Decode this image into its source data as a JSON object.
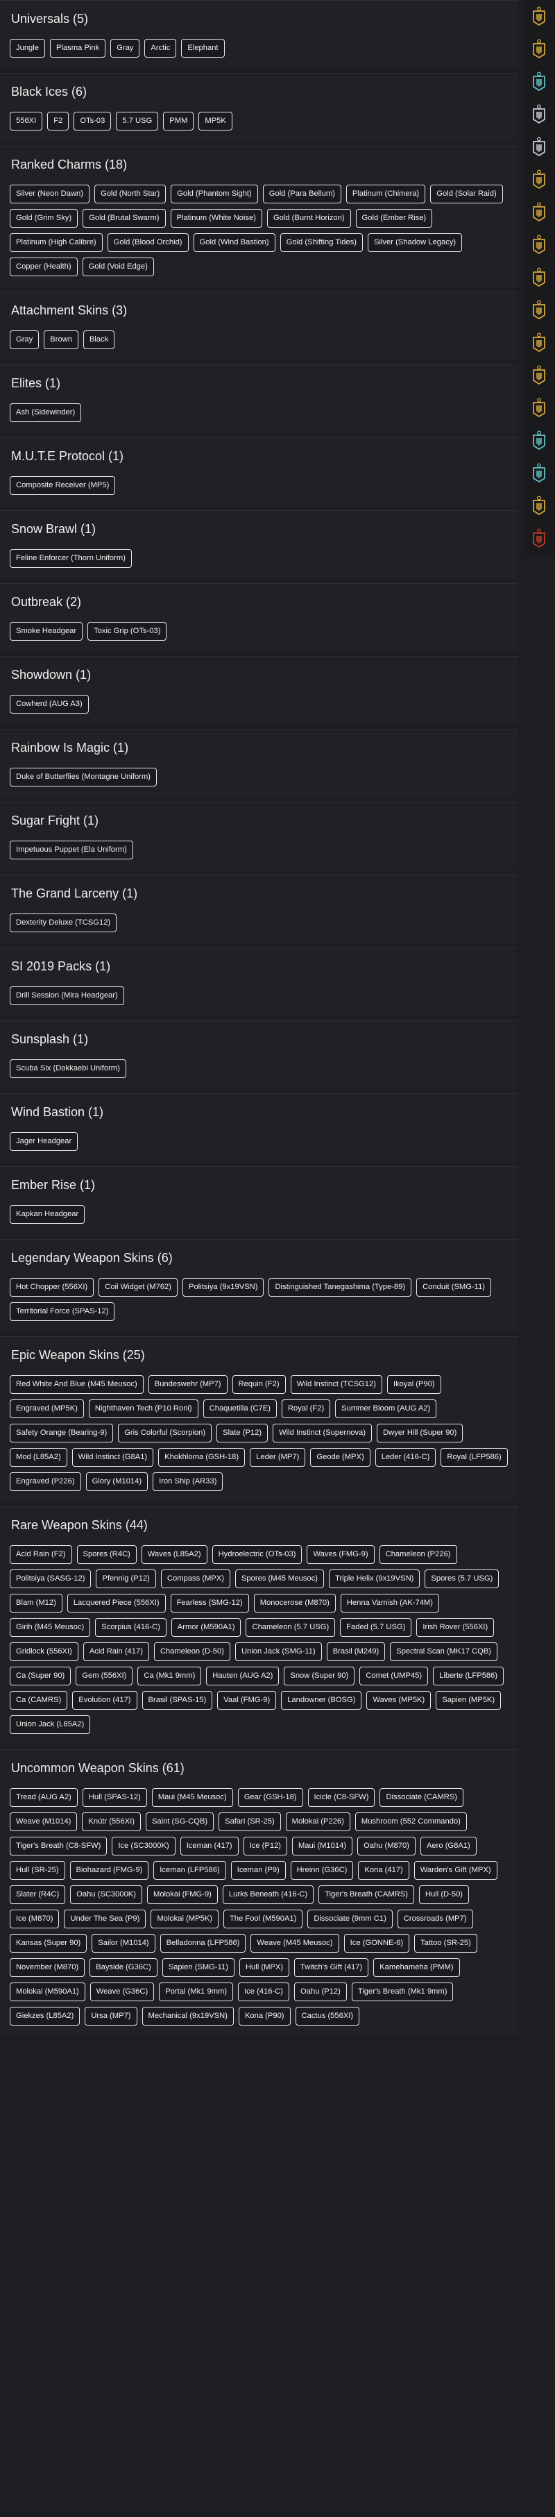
{
  "sections": [
    {
      "title": "Universals (5)",
      "items": [
        "Jungle",
        "Plasma Pink",
        "Gray",
        "Arctic",
        "Elephant"
      ]
    },
    {
      "title": "Black Ices (6)",
      "items": [
        "556XI",
        "F2",
        "OTs-03",
        "5.7 USG",
        "PMM",
        "MP5K"
      ]
    },
    {
      "title": "Ranked Charms (18)",
      "items": [
        "Silver (Neon Dawn)",
        "Gold (North Star)",
        "Gold (Phantom Sight)",
        "Gold (Para Bellum)",
        "Platinum (Chimera)",
        "Gold (Solar Raid)",
        "Gold (Grim Sky)",
        "Gold (Brutal Swarm)",
        "Platinum (White Noise)",
        "Gold (Burnt Horizon)",
        "Gold (Ember Rise)",
        "Platinum (High Calibre)",
        "Gold (Blood Orchid)",
        "Gold (Wind Bastion)",
        "Gold (Shifting Tides)",
        "Silver (Shadow Legacy)",
        "Copper (Health)",
        "Gold (Void Edge)"
      ]
    },
    {
      "title": "Attachment Skins (3)",
      "items": [
        "Gray",
        "Brown",
        "Black"
      ]
    },
    {
      "title": "Elites (1)",
      "items": [
        "Ash (Sidewinder)"
      ]
    },
    {
      "title": "M.U.T.E Protocol (1)",
      "items": [
        "Composite Receiver (MP5)"
      ]
    },
    {
      "title": "Snow Brawl (1)",
      "items": [
        "Feline Enforcer (Thorn Uniform)"
      ]
    },
    {
      "title": "Outbreak (2)",
      "items": [
        "Smoke Headgear",
        "Toxic Grip (OTs-03)"
      ]
    },
    {
      "title": "Showdown (1)",
      "items": [
        "Cowherd (AUG A3)"
      ]
    },
    {
      "title": "Rainbow Is Magic (1)",
      "items": [
        "Duke of Butterflies (Montagne Uniform)"
      ]
    },
    {
      "title": "Sugar Fright (1)",
      "items": [
        "Impetuous Puppet (Ela Uniform)"
      ]
    },
    {
      "title": "The Grand Larceny (1)",
      "items": [
        "Dexterity Deluxe (TCSG12)"
      ]
    },
    {
      "title": "SI 2019 Packs (1)",
      "items": [
        "Drill Session (Mira Headgear)"
      ]
    },
    {
      "title": "Sunsplash (1)",
      "items": [
        "Scuba Six (Dokkaebi Uniform)"
      ]
    },
    {
      "title": "Wind Bastion (1)",
      "items": [
        "Jager Headgear"
      ]
    },
    {
      "title": "Ember Rise (1)",
      "items": [
        "Kapkan Headgear"
      ]
    },
    {
      "title": "Legendary Weapon Skins (6)",
      "items": [
        "Hot Chopper (556XI)",
        "Coil Widget (M762)",
        "Politsiya (9x19VSN)",
        "Distinguished Tanegashima (Type-89)",
        "Conduit (SMG-11)",
        "Territorial Force (SPAS-12)"
      ]
    },
    {
      "title": "Epic Weapon Skins (25)",
      "items": [
        "Red White And Blue (M45 Meusoc)",
        "Bundeswehr (MP7)",
        "Requin (F2)",
        "Wild Instinct (TCSG12)",
        "Ikoyal (P90)",
        "Engraved (MP5K)",
        "Nighthaven Tech (P10 Roni)",
        "Chaquetilla (C7E)",
        "Royal (F2)",
        "Summer Bloom (AUG A2)",
        "Safety Orange (Bearing-9)",
        "Gris Colorful (Scorpion)",
        "Slate (P12)",
        "Wild Instinct (Supernova)",
        "Dwyer Hill (Super 90)",
        "Mod (L85A2)",
        "Wild Instinct (G8A1)",
        "Khokhloma (GSH-18)",
        "Leder (MP7)",
        "Geode (MPX)",
        "Leder (416-C)",
        "Royal (LFP586)",
        "Engraved (P226)",
        "Glory (M1014)",
        "Iron Ship (AR33)"
      ]
    },
    {
      "title": "Rare Weapon Skins (44)",
      "items": [
        "Acid Rain (F2)",
        "Spores (R4C)",
        "Waves (L85A2)",
        "Hydroelectric (OTs-03)",
        "Waves (FMG-9)",
        "Chameleon (P226)",
        "Politsiya (SASG-12)",
        "Pfennig (P12)",
        "Compass (MPX)",
        "Spores (M45 Meusoc)",
        "Triple Helix (9x19VSN)",
        "Spores (5.7 USG)",
        "Blam (M12)",
        "Lacquered Piece (556XI)",
        "Fearless (SMG-12)",
        "Monocerose (M870)",
        "Henna Varnish (AK-74M)",
        "Girih (M45 Meusoc)",
        "Scorpius (416-C)",
        "Armor (M590A1)",
        "Chameleon (5.7 USG)",
        "Faded (5.7 USG)",
        "Irish Rover (556XI)",
        "Gridlock (556XI)",
        "Acid Rain (417)",
        "Chameleon (D-50)",
        "Union Jack (SMG-11)",
        "Brasil (M249)",
        "Spectral Scan (MK17 CQB)",
        "Ca (Super 90)",
        "Gem (556XI)",
        "Ca (Mk1 9mm)",
        "Hauten (AUG A2)",
        "Snow (Super 90)",
        "Comet (UMP45)",
        "Liberte (LFP586)",
        "Ca (CAMRS)",
        "Evolution (417)",
        "Brasil (SPAS-15)",
        "Vaal (FMG-9)",
        "Landowner (BOSG)",
        "Waves (MP5K)",
        "Sapien (MP5K)",
        "Union Jack (L85A2)"
      ]
    },
    {
      "title": "Uncommon Weapon Skins (61)",
      "items": [
        "Tread (AUG A2)",
        "Hull (SPAS-12)",
        "Maui (M45 Meusoc)",
        "Gear (GSH-18)",
        "Icicle (C8-SFW)",
        "Dissociate (CAMRS)",
        "Weave (M1014)",
        "Knútr (556XI)",
        "Saint (SG-CQB)",
        "Safari (SR-25)",
        "Molokai (P226)",
        "Mushroom (552 Commando)",
        "Tiger's Breath (C8-SFW)",
        "Ice (SC3000K)",
        "Iceman (417)",
        "Ice (P12)",
        "Maui (M1014)",
        "Oahu (M870)",
        "Aero (G8A1)",
        "Hull (SR-25)",
        "Biohazard (FMG-9)",
        "Iceman (LFP586)",
        "Iceman (P9)",
        "Hreinn (G36C)",
        "Kona (417)",
        "Warden's Gift (MPX)",
        "Slater (R4C)",
        "Oahu (SC3000K)",
        "Molokai (FMG-9)",
        "Lurks Beneath (416-C)",
        "Tiger's Breath (CAMRS)",
        "Hull (D-50)",
        "Ice (M870)",
        "Under The Sea (P9)",
        "Molokai (MP5K)",
        "The Fool (M590A1)",
        "Dissociate (9mm C1)",
        "Crossroads (MP7)",
        "Kansas (Super 90)",
        "Sailor (M1014)",
        "Belladonna (LFP586)",
        "Weave (M45 Meusoc)",
        "Ice (GONNE-6)",
        "Tattoo (SR-25)",
        "November (M870)",
        "Bayside (G36C)",
        "Sapien (SMG-11)",
        "Hull (MPX)",
        "Twitch's Gift (417)",
        "Kamehameha (PMM)",
        "Molokai (M590A1)",
        "Weave (G36C)",
        "Portal (Mk1 9mm)",
        "Ice (416-C)",
        "Oahu (P12)",
        "Tiger's Breath (Mk1 9mm)",
        "Giekzes (L85A2)",
        "Ursa (MP7)",
        "Mechanical (9x19VSN)",
        "Kona (P90)",
        "Cactus (556XI)"
      ]
    }
  ],
  "rail": [
    {
      "icon": "gold-charm-icon",
      "color": "#d4a83a"
    },
    {
      "icon": "gold-charm-icon",
      "color": "#d4a83a"
    },
    {
      "icon": "platinum-charm-icon",
      "color": "#5fc3c9"
    },
    {
      "icon": "silver-charm-icon",
      "color": "#c9ccd2"
    },
    {
      "icon": "silver-charm-icon",
      "color": "#c9ccd2"
    },
    {
      "icon": "gold-charm-icon",
      "color": "#d4a83a"
    },
    {
      "icon": "gold-charm-icon",
      "color": "#d4a83a"
    },
    {
      "icon": "gold-charm-icon",
      "color": "#d4a83a"
    },
    {
      "icon": "gold-charm-icon",
      "color": "#d4a83a"
    },
    {
      "icon": "gold-charm-icon",
      "color": "#d4a83a"
    },
    {
      "icon": "gold-charm-icon",
      "color": "#d4a83a"
    },
    {
      "icon": "gold-charm-icon",
      "color": "#d4a83a"
    },
    {
      "icon": "gold-charm-icon",
      "color": "#d4a83a"
    },
    {
      "icon": "platinum-charm-icon",
      "color": "#5fc3c9"
    },
    {
      "icon": "platinum-charm-icon",
      "color": "#5fc3c9"
    },
    {
      "icon": "gold-charm-icon",
      "color": "#d4a83a"
    },
    {
      "icon": "copper-charm-icon",
      "color": "#c0392b"
    }
  ]
}
